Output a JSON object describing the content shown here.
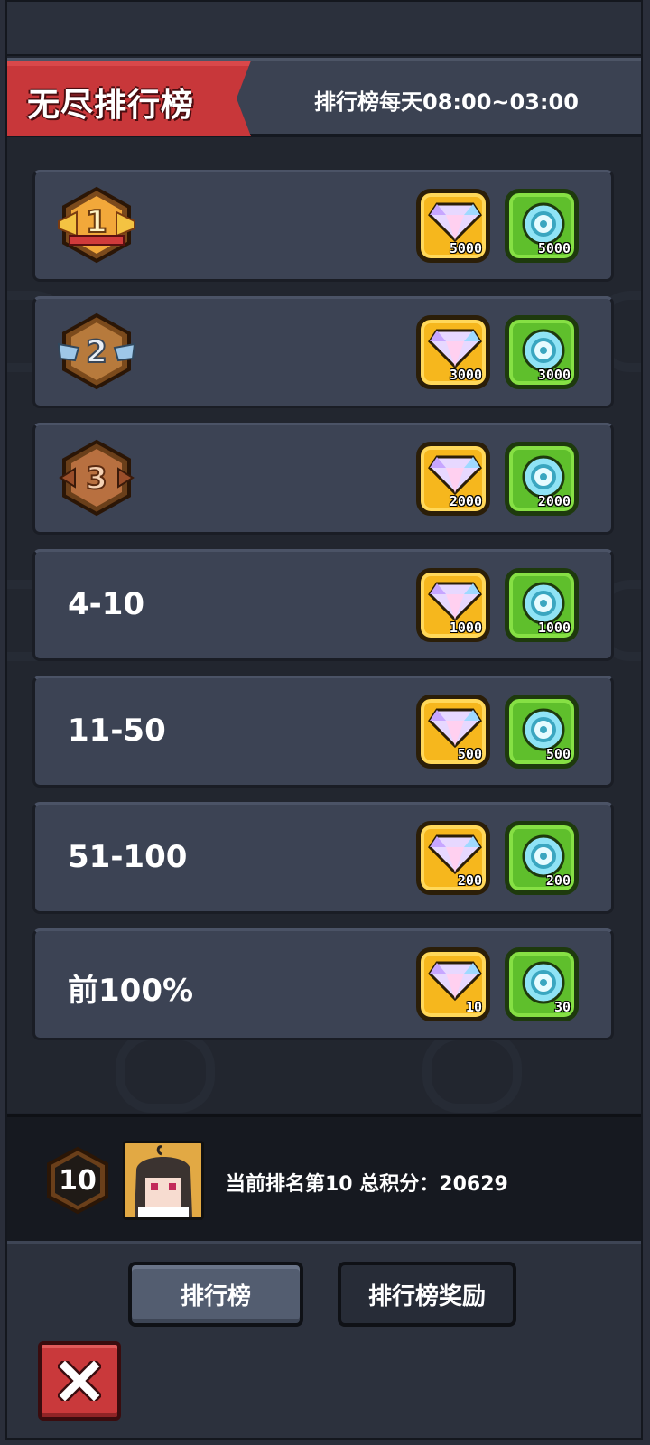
{
  "header": {
    "title": "无尽排行榜",
    "schedule": "排行榜每天08:00~03:00"
  },
  "rewards": [
    {
      "rank_label": "1",
      "badge": "gold-medal",
      "gem": "5000",
      "coin": "5000"
    },
    {
      "rank_label": "2",
      "badge": "silver-medal",
      "gem": "3000",
      "coin": "3000"
    },
    {
      "rank_label": "3",
      "badge": "bronze-medal",
      "gem": "2000",
      "coin": "2000"
    },
    {
      "rank_label": "4-10",
      "gem": "1000",
      "coin": "1000"
    },
    {
      "rank_label": "11-50",
      "gem": "500",
      "coin": "500"
    },
    {
      "rank_label": "51-100",
      "gem": "200",
      "coin": "200"
    },
    {
      "rank_label": "前100%",
      "gem": "10",
      "coin": "30"
    }
  ],
  "me": {
    "rank": "10",
    "status": "当前排名第10 总积分：20629"
  },
  "footer": {
    "tab_rank": "排行榜",
    "tab_reward": "排行榜奖励"
  },
  "colors": {
    "accent_red": "#c8373a",
    "gem_bg": "#f6b71d",
    "coin_bg": "#5fbf2c",
    "panel_bg": "#3c4354"
  }
}
